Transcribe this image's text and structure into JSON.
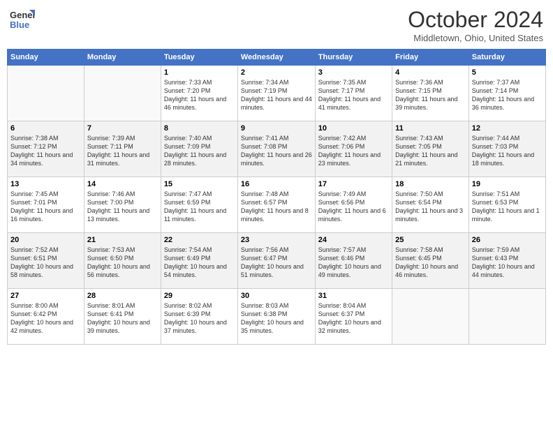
{
  "header": {
    "logo_line1": "General",
    "logo_line2": "Blue",
    "month": "October 2024",
    "location": "Middletown, Ohio, United States"
  },
  "days_of_week": [
    "Sunday",
    "Monday",
    "Tuesday",
    "Wednesday",
    "Thursday",
    "Friday",
    "Saturday"
  ],
  "weeks": [
    [
      {
        "day": "",
        "info": ""
      },
      {
        "day": "",
        "info": ""
      },
      {
        "day": "1",
        "info": "Sunrise: 7:33 AM\nSunset: 7:20 PM\nDaylight: 11 hours and 46 minutes."
      },
      {
        "day": "2",
        "info": "Sunrise: 7:34 AM\nSunset: 7:19 PM\nDaylight: 11 hours and 44 minutes."
      },
      {
        "day": "3",
        "info": "Sunrise: 7:35 AM\nSunset: 7:17 PM\nDaylight: 11 hours and 41 minutes."
      },
      {
        "day": "4",
        "info": "Sunrise: 7:36 AM\nSunset: 7:15 PM\nDaylight: 11 hours and 39 minutes."
      },
      {
        "day": "5",
        "info": "Sunrise: 7:37 AM\nSunset: 7:14 PM\nDaylight: 11 hours and 36 minutes."
      }
    ],
    [
      {
        "day": "6",
        "info": "Sunrise: 7:38 AM\nSunset: 7:12 PM\nDaylight: 11 hours and 34 minutes."
      },
      {
        "day": "7",
        "info": "Sunrise: 7:39 AM\nSunset: 7:11 PM\nDaylight: 11 hours and 31 minutes."
      },
      {
        "day": "8",
        "info": "Sunrise: 7:40 AM\nSunset: 7:09 PM\nDaylight: 11 hours and 28 minutes."
      },
      {
        "day": "9",
        "info": "Sunrise: 7:41 AM\nSunset: 7:08 PM\nDaylight: 11 hours and 26 minutes."
      },
      {
        "day": "10",
        "info": "Sunrise: 7:42 AM\nSunset: 7:06 PM\nDaylight: 11 hours and 23 minutes."
      },
      {
        "day": "11",
        "info": "Sunrise: 7:43 AM\nSunset: 7:05 PM\nDaylight: 11 hours and 21 minutes."
      },
      {
        "day": "12",
        "info": "Sunrise: 7:44 AM\nSunset: 7:03 PM\nDaylight: 11 hours and 18 minutes."
      }
    ],
    [
      {
        "day": "13",
        "info": "Sunrise: 7:45 AM\nSunset: 7:01 PM\nDaylight: 11 hours and 16 minutes."
      },
      {
        "day": "14",
        "info": "Sunrise: 7:46 AM\nSunset: 7:00 PM\nDaylight: 11 hours and 13 minutes."
      },
      {
        "day": "15",
        "info": "Sunrise: 7:47 AM\nSunset: 6:59 PM\nDaylight: 11 hours and 11 minutes."
      },
      {
        "day": "16",
        "info": "Sunrise: 7:48 AM\nSunset: 6:57 PM\nDaylight: 11 hours and 8 minutes."
      },
      {
        "day": "17",
        "info": "Sunrise: 7:49 AM\nSunset: 6:56 PM\nDaylight: 11 hours and 6 minutes."
      },
      {
        "day": "18",
        "info": "Sunrise: 7:50 AM\nSunset: 6:54 PM\nDaylight: 11 hours and 3 minutes."
      },
      {
        "day": "19",
        "info": "Sunrise: 7:51 AM\nSunset: 6:53 PM\nDaylight: 11 hours and 1 minute."
      }
    ],
    [
      {
        "day": "20",
        "info": "Sunrise: 7:52 AM\nSunset: 6:51 PM\nDaylight: 10 hours and 58 minutes."
      },
      {
        "day": "21",
        "info": "Sunrise: 7:53 AM\nSunset: 6:50 PM\nDaylight: 10 hours and 56 minutes."
      },
      {
        "day": "22",
        "info": "Sunrise: 7:54 AM\nSunset: 6:49 PM\nDaylight: 10 hours and 54 minutes."
      },
      {
        "day": "23",
        "info": "Sunrise: 7:56 AM\nSunset: 6:47 PM\nDaylight: 10 hours and 51 minutes."
      },
      {
        "day": "24",
        "info": "Sunrise: 7:57 AM\nSunset: 6:46 PM\nDaylight: 10 hours and 49 minutes."
      },
      {
        "day": "25",
        "info": "Sunrise: 7:58 AM\nSunset: 6:45 PM\nDaylight: 10 hours and 46 minutes."
      },
      {
        "day": "26",
        "info": "Sunrise: 7:59 AM\nSunset: 6:43 PM\nDaylight: 10 hours and 44 minutes."
      }
    ],
    [
      {
        "day": "27",
        "info": "Sunrise: 8:00 AM\nSunset: 6:42 PM\nDaylight: 10 hours and 42 minutes."
      },
      {
        "day": "28",
        "info": "Sunrise: 8:01 AM\nSunset: 6:41 PM\nDaylight: 10 hours and 39 minutes."
      },
      {
        "day": "29",
        "info": "Sunrise: 8:02 AM\nSunset: 6:39 PM\nDaylight: 10 hours and 37 minutes."
      },
      {
        "day": "30",
        "info": "Sunrise: 8:03 AM\nSunset: 6:38 PM\nDaylight: 10 hours and 35 minutes."
      },
      {
        "day": "31",
        "info": "Sunrise: 8:04 AM\nSunset: 6:37 PM\nDaylight: 10 hours and 32 minutes."
      },
      {
        "day": "",
        "info": ""
      },
      {
        "day": "",
        "info": ""
      }
    ]
  ]
}
